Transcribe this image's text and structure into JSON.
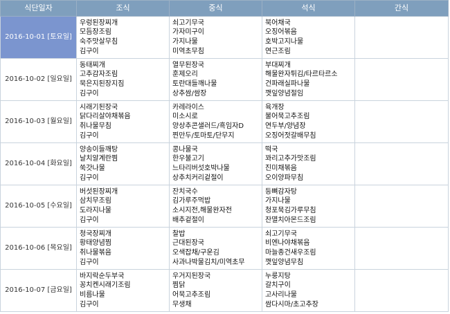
{
  "headers": [
    "식단일자",
    "조식",
    "중식",
    "석식",
    "간식"
  ],
  "rows": [
    {
      "date": "2016-10-01 [토요일]",
      "breakfast": [
        "우렁된장찌개",
        "모듬장조림",
        "숙주맛살무침",
        "김구이"
      ],
      "lunch": [
        "쇠고기무국",
        "가자미구이",
        "가지나물",
        "미역초무침"
      ],
      "dinner": [
        "북어채국",
        "오징어볶음",
        "호박고지나물",
        "연근조림"
      ],
      "snack": []
    },
    {
      "date": "2016-10-02 [일요일]",
      "breakfast": [
        "동태찌개",
        "고추감자조림",
        "묵은지된장지짐",
        "김구이"
      ],
      "lunch": [
        "열무된장국",
        "훈제오리",
        "토란대들깨나물",
        "상추쌈/쌈장"
      ],
      "dinner": [
        "부대찌개",
        "해물완자튀김/타르타르소",
        "건파래실파나물",
        "깻잎양념절임"
      ],
      "snack": []
    },
    {
      "date": "2016-10-03 [월요일]",
      "breakfast": [
        "시래기된장국",
        "닭다리살야채볶음",
        "취나물무침",
        "김구이"
      ],
      "lunch": [
        "카레라이스",
        "미소시로",
        "양상추콘샐러드/흑임자D",
        "찐만두/토마토/단무지"
      ],
      "dinner": [
        "육개장",
        "불어묵고추조림",
        "연두부/양념장",
        "오징어젓갈배무침"
      ],
      "snack": []
    },
    {
      "date": "2016-10-04 [화요일]",
      "breakfast": [
        "양송이들깨탕",
        "날치알계란찜",
        "쑥갓나물",
        "김구이"
      ],
      "lunch": [
        "콩나물국",
        "한우불고기",
        "느타리버섯호박나물",
        "상추치커리겉절이"
      ],
      "dinner": [
        "떡국",
        "꽈리고추가맛조림",
        "진미채볶음",
        "오이양파무침"
      ],
      "snack": []
    },
    {
      "date": "2016-10-05 [수요일]",
      "breakfast": [
        "버섯된장찌개",
        "삼치무조림",
        "도라지나물",
        "김구이"
      ],
      "lunch": [
        "잔치국수",
        "김가루주먹밥",
        "소시지전,해물완자전",
        "배추겉절이"
      ],
      "dinner": [
        "등뼈감자탕",
        "가지나물",
        "청포묵김가루무침",
        "잔멸치아몬드조림"
      ],
      "snack": []
    },
    {
      "date": "2016-10-06 [목요일]",
      "breakfast": [
        "청국장찌개",
        "황태양념찜",
        "취나물볶음",
        "김구이"
      ],
      "lunch": [
        "찰밥",
        "근대된장국",
        "오색잡채/구운김",
        "사과나박물김치/미역초무"
      ],
      "dinner": [
        "쇠고기무국",
        "비엔나야채볶음",
        "마늘종건새우조림",
        "깻잎양념무침"
      ],
      "snack": []
    },
    {
      "date": "2016-10-07 [금요일]",
      "breakfast": [
        "바지락순두부국",
        "꽁치켄시래기조림",
        "비름나물",
        "김구이"
      ],
      "lunch": [
        "우거지된장국",
        "찜닭",
        "어묵고추조림",
        "무생채"
      ],
      "dinner": [
        "누룽지탕",
        "갈치구이",
        "고사리나물",
        "쌈다시마/초고추장"
      ],
      "snack": []
    }
  ]
}
